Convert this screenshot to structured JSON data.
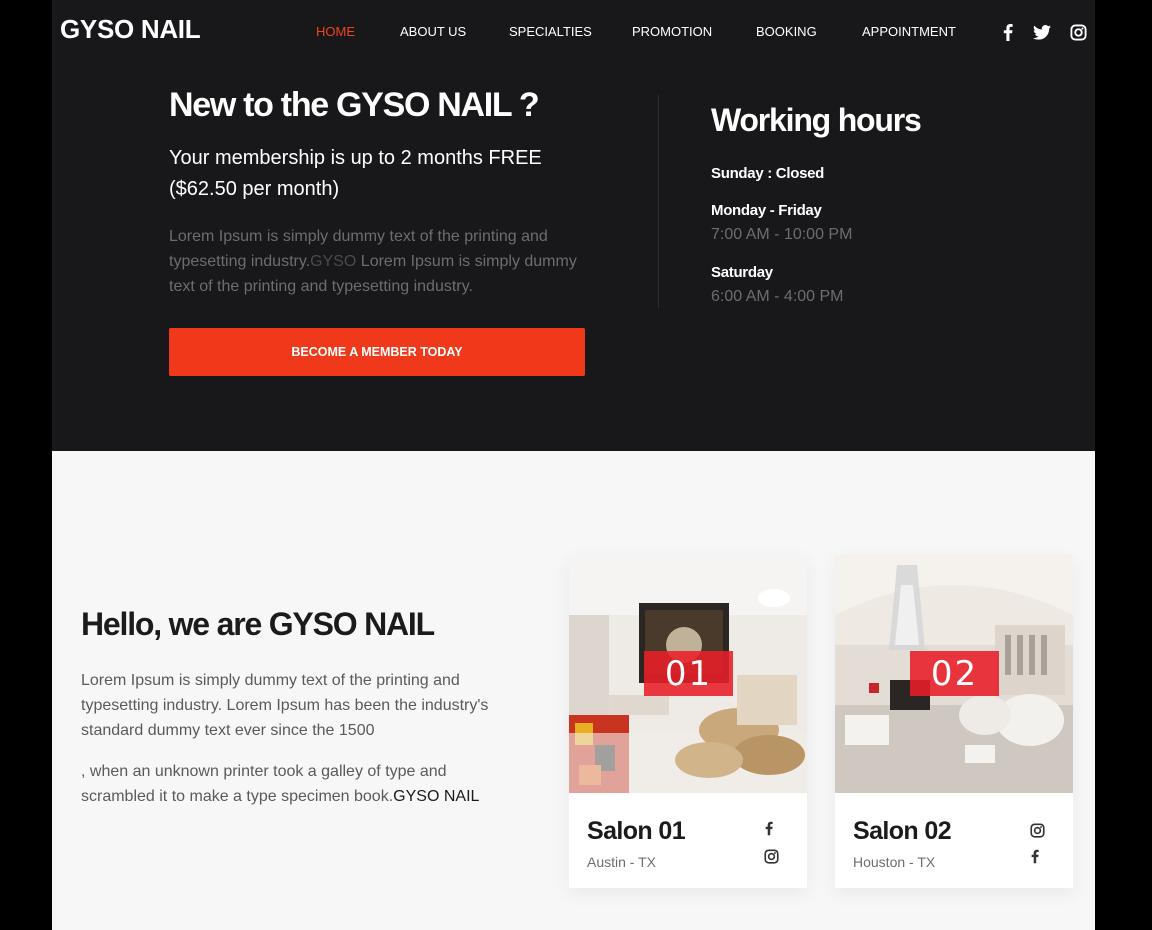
{
  "brand": {
    "logo": "GYSO NAIL",
    "accent": "#f0451b"
  },
  "nav": {
    "items": [
      {
        "label": "HOME",
        "active": true
      },
      {
        "label": "ABOUT US",
        "active": false
      },
      {
        "label": "SPECIALTIES",
        "active": false
      },
      {
        "label": "PROMOTION",
        "active": false
      },
      {
        "label": "BOOKING",
        "active": false
      },
      {
        "label": "APPOINTMENT",
        "active": false
      }
    ],
    "social": [
      "facebook-icon",
      "twitter-icon",
      "instagram-icon"
    ]
  },
  "promo": {
    "title": "New to the GYSO NAIL ?",
    "subtitle_line1": "Your membership is up to 2 months FREE",
    "subtitle_line2": "($62.50 per month)",
    "body_part1": "Lorem Ipsum is simply dummy text of the printing and typesetting industry.",
    "body_highlight": "GYSO",
    "body_part2": " Lorem Ipsum is simply dummy text of the printing and typesetting industry.",
    "cta_label": "BECOME A MEMBER TODAY"
  },
  "hours": {
    "title": "Working hours",
    "sunday": "Sunday : Closed",
    "weekday_label": "Monday - Friday",
    "weekday_time": "7:00 AM - 10:00 PM",
    "saturday_label": "Saturday",
    "saturday_time": "6:00 AM - 4:00 PM"
  },
  "about": {
    "title": "Hello, we are GYSO NAIL",
    "p1": "Lorem Ipsum is simply dummy text of the printing and typesetting industry. Lorem Ipsum has been the industry's standard dummy text ever since the 1500",
    "p2_part1": ", when an unknown printer took a galley of type and scrambled it to make a type specimen book.",
    "p2_highlight": "GYSO NAIL"
  },
  "salons": [
    {
      "number": "01",
      "name": "Salon 01",
      "location": "Austin - TX",
      "icons": [
        "facebook-icon",
        "instagram-icon"
      ]
    },
    {
      "number": "02",
      "name": "Salon 02",
      "location": "Houston - TX",
      "icons": [
        "instagram-icon",
        "facebook-icon"
      ]
    }
  ]
}
